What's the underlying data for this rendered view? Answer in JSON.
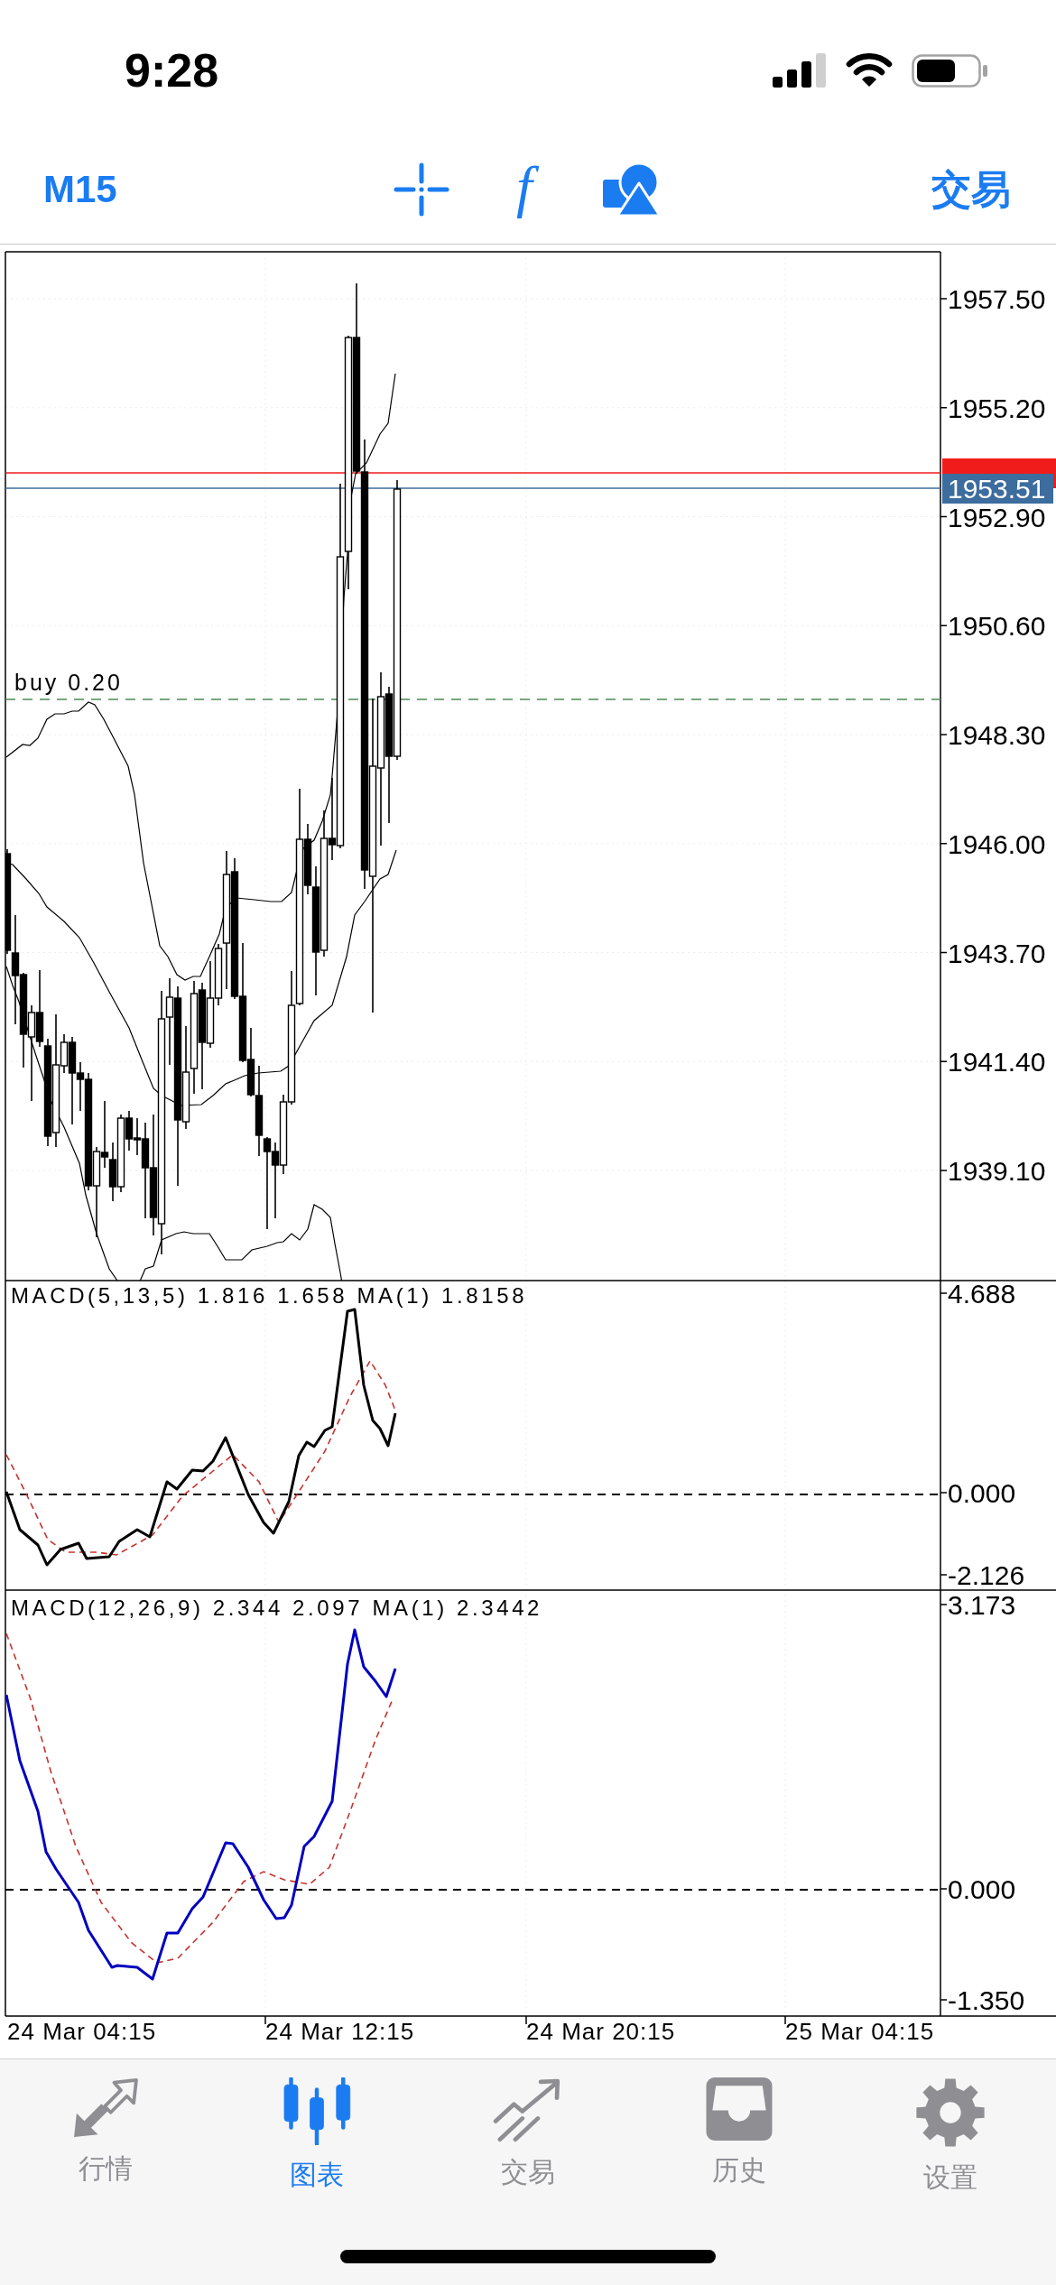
{
  "status_bar": {
    "time": "9:28"
  },
  "toolbar": {
    "timeframe": "M15",
    "indicator_glyph": "f",
    "trade_button": "交易"
  },
  "chart": {
    "price_axis": [
      "1957.50",
      "1955.20",
      "1952.90",
      "1950.60",
      "1948.30",
      "1946.00",
      "1943.70",
      "1941.40",
      "1939.10"
    ],
    "price_markers": [
      {
        "color": "#f01c1c"
      },
      {
        "text": "1953.51",
        "color": "#3d6c9e"
      }
    ],
    "order_line": {
      "label": "buy 0.20"
    },
    "indicators": [
      {
        "label": "MACD(5,13,5) 1.816 1.658 MA(1) 1.8158",
        "color": "#000000",
        "axis": [
          "4.688",
          "0.000",
          "-2.126"
        ]
      },
      {
        "label": "MACD(12,26,9) 2.344 2.097 MA(1) 2.3442",
        "color": "#0000c0",
        "axis": [
          "3.173",
          "0.000",
          "-1.350"
        ]
      }
    ],
    "time_axis": [
      "24 Mar 04:15",
      "24 Mar 12:15",
      "24 Mar 20:15",
      "25 Mar 04:15"
    ]
  },
  "tab_bar": [
    {
      "label": "行情",
      "selected": false
    },
    {
      "label": "图表",
      "selected": true
    },
    {
      "label": "交易",
      "selected": false
    },
    {
      "label": "历史",
      "selected": false
    },
    {
      "label": "设置",
      "selected": false
    }
  ]
}
